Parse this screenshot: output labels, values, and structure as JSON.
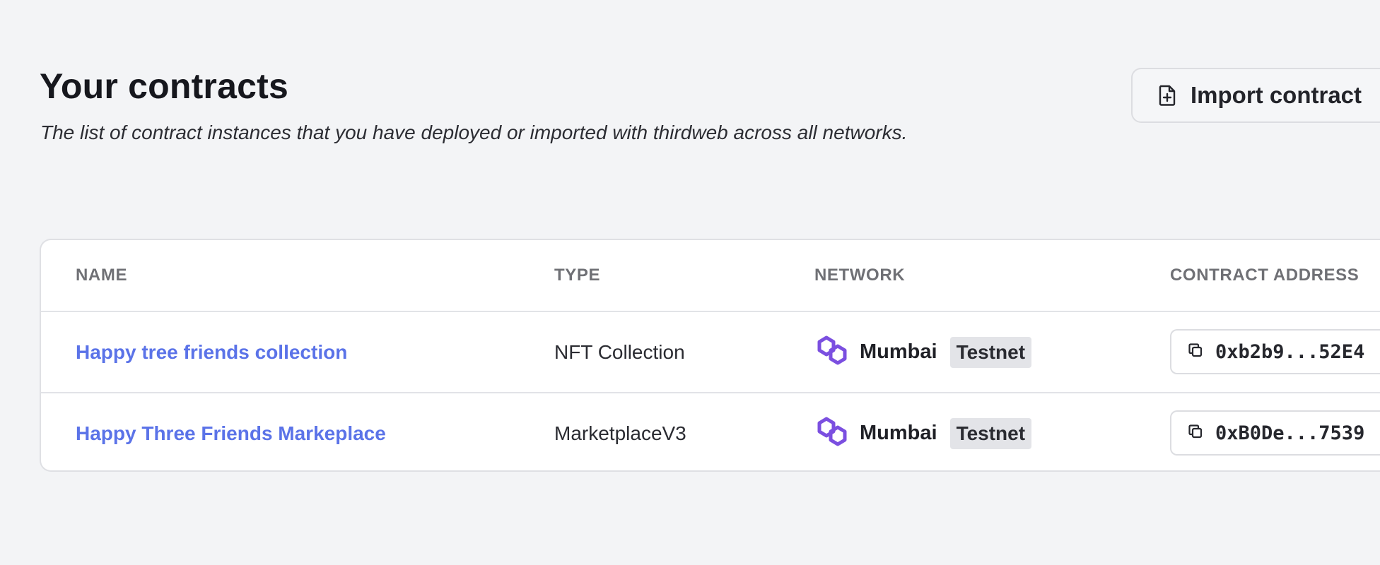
{
  "header": {
    "title": "Your contracts",
    "subtitle": "The list of contract instances that you have deployed or imported with thirdweb across all networks.",
    "import_label": "Import contract",
    "import_icon": "file-plus-icon"
  },
  "table": {
    "columns": [
      "NAME",
      "TYPE",
      "NETWORK",
      "CONTRACT ADDRESS"
    ],
    "rows": [
      {
        "name": "Happy tree friends collection",
        "type": "NFT Collection",
        "network": "Mumbai",
        "badge": "Testnet",
        "address": "0xb2b9...52E4"
      },
      {
        "name": "Happy Three Friends Markeplace",
        "type": "MarketplaceV3",
        "network": "Mumbai",
        "badge": "Testnet",
        "address": "0xB0De...7539"
      }
    ]
  },
  "colors": {
    "accent_link": "#5b73e8",
    "polygon": "#7b4fe0",
    "background": "#f3f4f6"
  },
  "icons": {
    "network": "polygon-icon",
    "copy": "copy-icon"
  }
}
